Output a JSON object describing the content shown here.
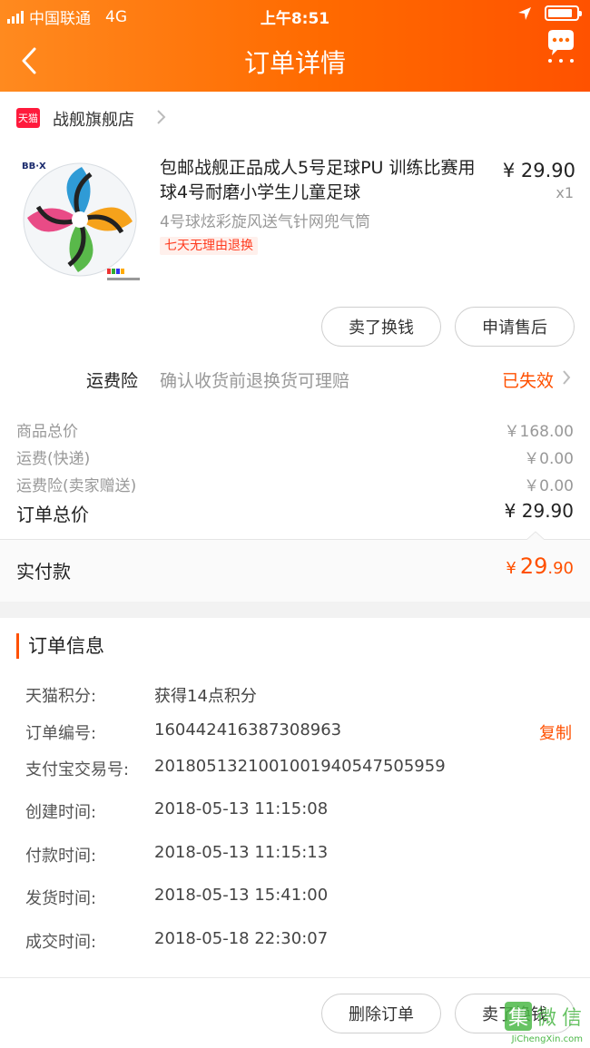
{
  "status_bar": {
    "carrier": "中国联通",
    "network": "4G",
    "time": "上午8:51"
  },
  "nav": {
    "title": "订单详情"
  },
  "shop": {
    "badge": "天猫",
    "name": "战舰旗舰店"
  },
  "product": {
    "title": "包邮战舰正品成人5号足球PU 训练比赛用球4号耐磨小学生儿童足球",
    "sku": "4号球炫彩旋风送气针网兜气筒",
    "tag": "七天无理由退换",
    "price": "¥ 29.90",
    "qty": "x1"
  },
  "actions": {
    "sell": "卖了换钱",
    "after_sale": "申请售后"
  },
  "insurance": {
    "label": "运费险",
    "desc": "确认收货前退换货可理赔",
    "status": "已失效"
  },
  "summary": {
    "rows": [
      {
        "label": "商品总价",
        "value": "￥168.00"
      },
      {
        "label": "运费(快递)",
        "value": "￥0.00"
      },
      {
        "label": "运费险(卖家赠送)",
        "value": "￥0.00"
      }
    ],
    "total_label": "订单总价",
    "total_value": "¥ 29.90",
    "paid_label": "实付款",
    "paid_currency": "¥",
    "paid_int": "29",
    "paid_dec": ".90"
  },
  "order_info": {
    "title": "订单信息",
    "rows": [
      {
        "label": "天猫积分:",
        "value": "获得14点积分"
      },
      {
        "label": "订单编号:",
        "value": "160442416387308963"
      },
      {
        "label": "支付宝交易号:",
        "value": "2018051321001001940547505959"
      },
      {
        "label": "创建时间:",
        "value": "2018-05-13 11:15:08"
      },
      {
        "label": "付款时间:",
        "value": "2018-05-13 11:15:13"
      },
      {
        "label": "发货时间:",
        "value": "2018-05-13 15:41:00"
      },
      {
        "label": "成交时间:",
        "value": "2018-05-18 22:30:07"
      }
    ],
    "copy_label": "复制"
  },
  "bottom": {
    "delete": "删除订单",
    "sell": "卖了换钱"
  },
  "watermark": {
    "logo": "集微信",
    "url": "JiChengXin.com"
  },
  "colors": {
    "accent": "#ff5000",
    "header_start": "#ff8a1f",
    "header_end": "#ff5200",
    "tmall": "#ff1a3c"
  }
}
